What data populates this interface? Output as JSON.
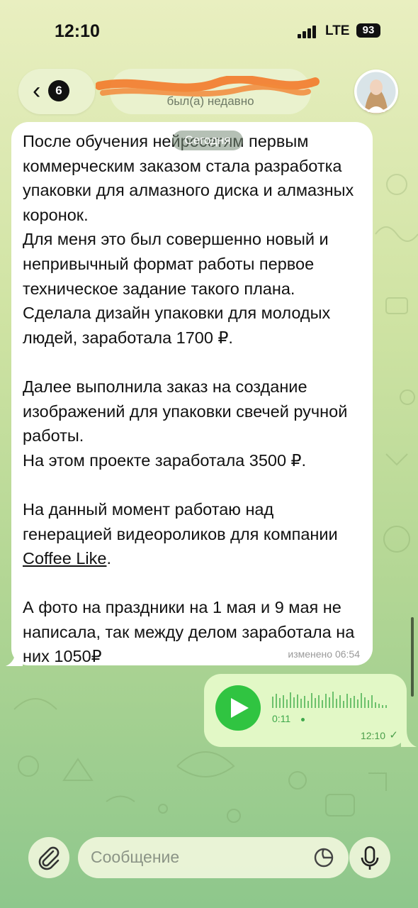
{
  "status_bar": {
    "time": "12:10",
    "network": "LTE",
    "battery": "93"
  },
  "header": {
    "back_count": "6",
    "contact_name": "",
    "contact_status": "был(а) недавно"
  },
  "date_separator": "Сегодня",
  "incoming_message": {
    "paragraphs": [
      "После обучения нейросетям первым коммерческим заказом стала разработка упаковки для алмазного диска и алмазных коронок.\nДля меня это был совершенно новый и непривычный формат работы первое техническое задание такого плана.\nСделала дизайн упаковки для молодых людей, заработала 1700 ₽.",
      "Далее выполнила заказ на создание изображений для упаковки свечей ручной работы.\nНа этом проекте заработала 3500 ₽.",
      "На данный момент работаю над генерацией видеороликов для компании ",
      "А фото на праздники на 1 мая и 9 мая не написала, так между делом заработала на них 1050₽"
    ],
    "link_text": "Coffee Like",
    "link_suffix": ".",
    "meta": "изменено 06:54"
  },
  "outgoing_voice": {
    "duration": "0:11",
    "time": "12:10"
  },
  "input": {
    "placeholder": "Сообщение"
  },
  "colors": {
    "play": "#30c441",
    "out_bubble": "#e2f8c6",
    "in_bubble": "#ffffff"
  }
}
